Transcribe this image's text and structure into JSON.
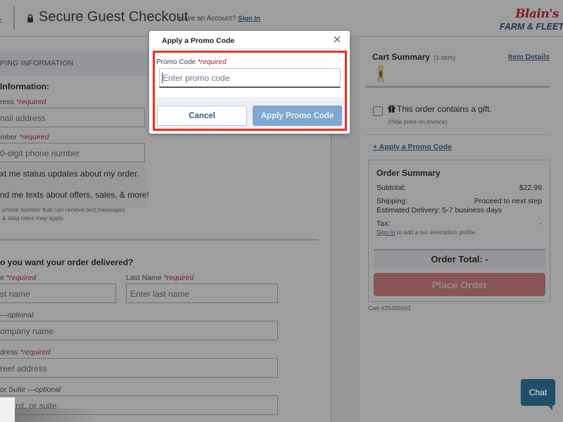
{
  "header": {
    "title": "Secure Guest Checkout",
    "account_prompt": "Have an Account?",
    "sign_in": "Sign In",
    "logo_top": "Blain's",
    "logo_bottom": "FARM & FLEET"
  },
  "shipping": {
    "section_label": "PING INFORMATION",
    "contact_heading": "Information:",
    "email_label": "ress",
    "email_required": "*required",
    "email_placeholder": "nail address",
    "phone_label": "mber",
    "phone_required": "*required",
    "phone_placeholder": "0-digit phone number",
    "sms_option_1": "xt me status updates about my order.",
    "sms_option_2": "nd me texts about offers, sales, & more!",
    "fine_print_1": "phone number that can receive text messages.",
    "fine_print_2": "& data rates may apply.",
    "delivery_heading": "o you want your order delivered?",
    "first_name_label": "e",
    "first_name_required": "*required",
    "first_name_placeholder": "st name",
    "last_name_label": "Last Name",
    "last_name_required": "*required",
    "last_name_placeholder": "Enter last name",
    "company_optional": "—optional",
    "company_placeholder": "ompany name",
    "address_label": "dress",
    "address_required": "*required",
    "address_placeholder": "reet address",
    "suite_label": "or Suite",
    "suite_optional": "—optional",
    "suite_placeholder": "nit, or suite"
  },
  "cart": {
    "title": "Cart Summary",
    "count": "(1 item)",
    "item_details": "Item Details",
    "gift_text": "This order contains a gift.",
    "gift_sub": "(Hide price on invoice)",
    "apply_promo_link": "+ Apply a Promo Code",
    "summary_title": "Order Summary",
    "subtotal_label": "Subtotal:",
    "subtotal_value": "$22.99",
    "shipping_label": "Shipping:",
    "shipping_value": "Proceed to next step",
    "delivery_estimate": "Estimated Delivery: 5-7 business days",
    "tax_label": "Tax:",
    "tax_value": "-",
    "tax_sign_in": "Sign In",
    "tax_note": "to add a tax exemption profile.",
    "order_total": "Order Total: -",
    "place_order": "Place Order",
    "cart_number": "Cart #25485691"
  },
  "modal": {
    "title": "Apply a Promo Code",
    "field_label": "Promo Code",
    "field_required": "*required",
    "placeholder": "Enter promo code",
    "value": "",
    "cancel": "Cancel",
    "apply": "Apply Promo Code"
  },
  "chat": {
    "label": "Chat"
  },
  "colors": {
    "accent_blue": "#2a5a86",
    "required_red": "#b5132b",
    "highlight_red": "#f0301e",
    "place_order": "#d8797a",
    "apply_button": "#7ea8cf",
    "chat": "#1f4f6a"
  }
}
